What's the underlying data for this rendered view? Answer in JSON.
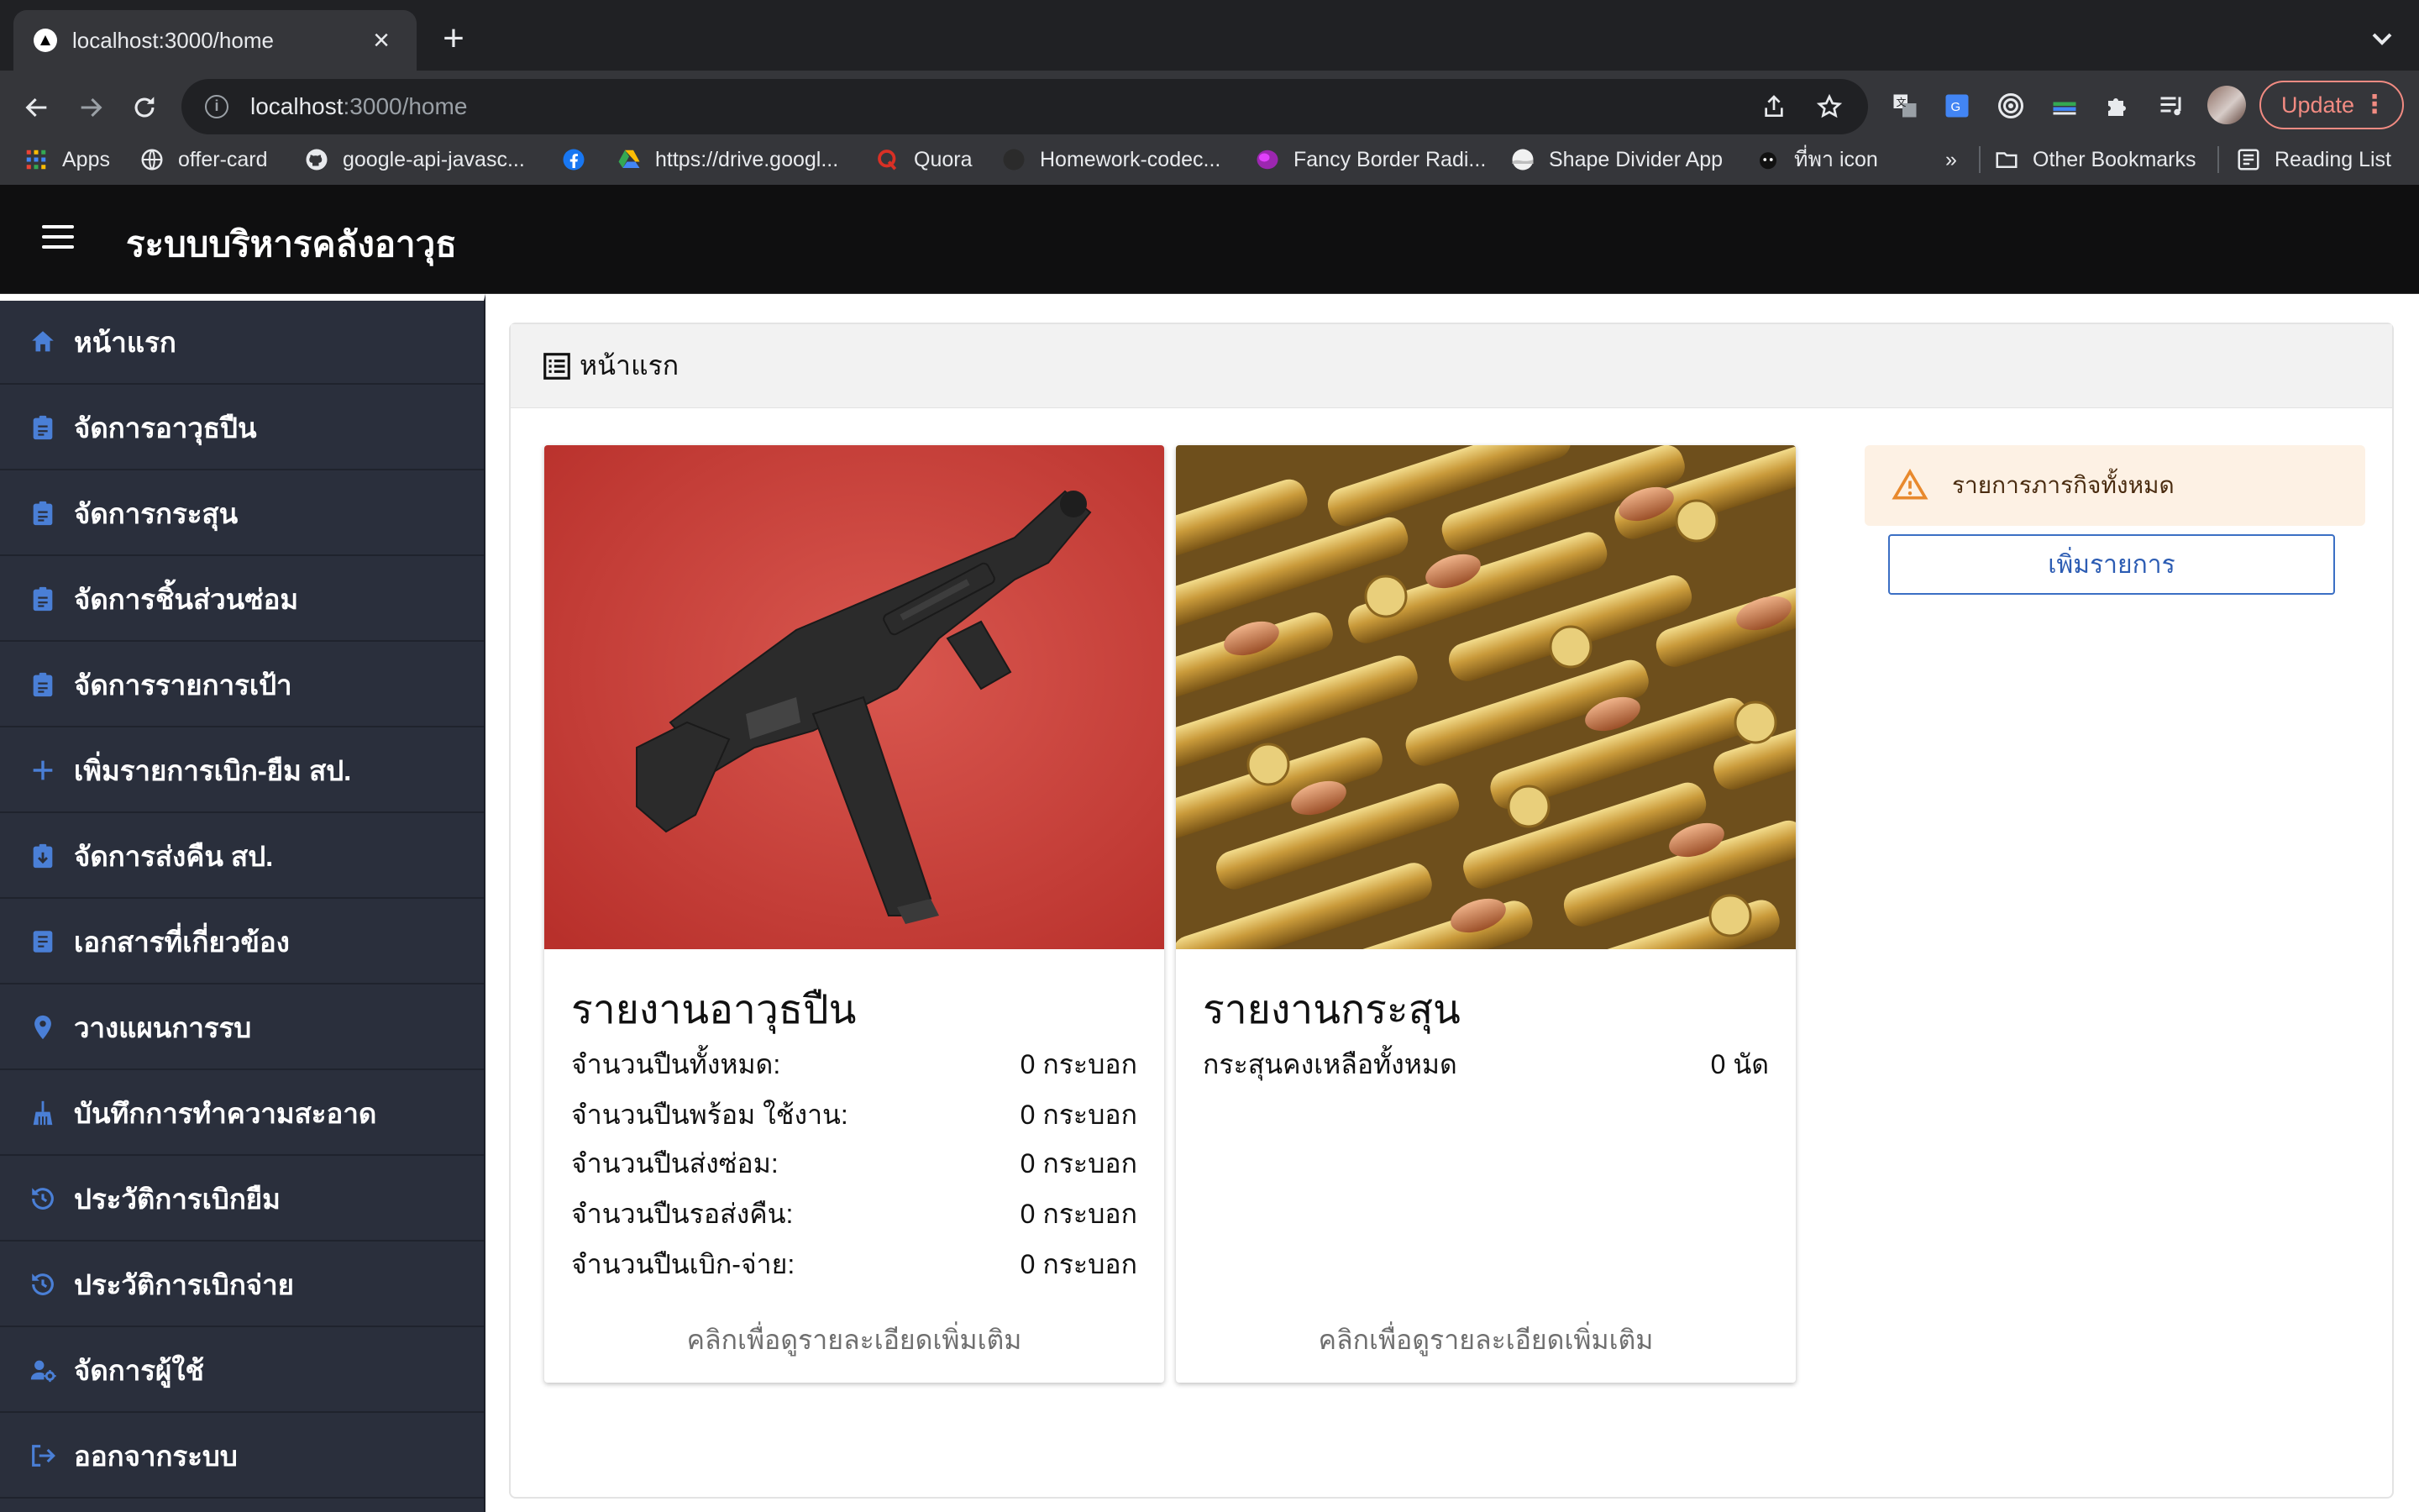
{
  "browser": {
    "tab_title": "localhost:3000/home",
    "tab_close": "×",
    "new_tab": "+",
    "url_host": "localhost",
    "url_path": ":3000/home",
    "update_label": "Update",
    "update_dots": "⋮"
  },
  "bookmarks": {
    "items": [
      {
        "label": "Apps",
        "icon": "apps-grid-icon"
      },
      {
        "label": "offer-card",
        "icon": "globe-icon"
      },
      {
        "label": "google-api-javasc...",
        "icon": "github-icon"
      },
      {
        "label": "",
        "icon": "facebook-icon"
      },
      {
        "label": "https://drive.googl...",
        "icon": "google-drive-icon"
      },
      {
        "label": "Quora",
        "icon": "quora-icon"
      },
      {
        "label": "Homework-codec...",
        "icon": "codecamp-icon"
      },
      {
        "label": "Fancy Border Radi...",
        "icon": "purple-blob-icon"
      },
      {
        "label": "Shape Divider App",
        "icon": "shape-divider-icon"
      },
      {
        "label": "ที่พา icon",
        "icon": "emoji-icon"
      }
    ],
    "overflow": "»",
    "other_bookmarks": "Other Bookmarks",
    "reading_list": "Reading List"
  },
  "app": {
    "title": "ระบบบริหารคลังอาวุธ"
  },
  "sidebar": {
    "items": [
      {
        "label": "หน้าแรก",
        "icon": "home-icon"
      },
      {
        "label": "จัดการอาวุธปืน",
        "icon": "clipboard-icon"
      },
      {
        "label": "จัดการกระสุน",
        "icon": "clipboard-icon"
      },
      {
        "label": "จัดการชิ้นส่วนซ่อม",
        "icon": "clipboard-icon"
      },
      {
        "label": "จัดการรายการเป้า",
        "icon": "clipboard-icon"
      },
      {
        "label": "เพิ่มรายการเบิก-ยืม สป.",
        "icon": "plus-icon"
      },
      {
        "label": "จัดการส่งคืน สป.",
        "icon": "clipboard-return-icon"
      },
      {
        "label": "เอกสารที่เกี่ยวข้อง",
        "icon": "document-icon"
      },
      {
        "label": "วางแผนการรบ",
        "icon": "location-pin-icon"
      },
      {
        "label": "บันทึกการทำความสะอาด",
        "icon": "cleaning-broom-icon"
      },
      {
        "label": "ประวัติการเบิกยืม",
        "icon": "history-icon"
      },
      {
        "label": "ประวัติการเบิกจ่าย",
        "icon": "history-icon"
      },
      {
        "label": "จัดการผู้ใช้",
        "icon": "manage-users-icon"
      },
      {
        "label": "ออกจากระบบ",
        "icon": "logout-icon"
      }
    ]
  },
  "main": {
    "header_title": "หน้าแรก",
    "gun_card": {
      "title": "รายงานอาวุธปืน",
      "stats": [
        {
          "label": "จำนวนปืนทั้งหมด:",
          "value": "0 กระบอก"
        },
        {
          "label": "จำนวนปืนพร้อม ใช้งาน:",
          "value": "0 กระบอก"
        },
        {
          "label": "จำนวนปืนส่งซ่อม:",
          "value": "0 กระบอก"
        },
        {
          "label": "จำนวนปืนรอส่งคืน:",
          "value": "0 กระบอก"
        },
        {
          "label": "จำนวนปืนเบิก-จ่าย:",
          "value": "0 กระบอก"
        }
      ],
      "more": "คลิกเพื่อดูรายละเอียดเพิ่มเติม"
    },
    "ammo_card": {
      "title": "รายงานกระสุน",
      "stats": [
        {
          "label": "กระสุนคงเหลือทั้งหมด",
          "value": "0 นัด"
        }
      ],
      "more": "คลิกเพื่อดูรายละเอียดเพิ่มเติม"
    },
    "tasks": {
      "alert_text": "รายการภารกิจทั้งหมด",
      "add_button": "เพิ่มรายการ"
    }
  },
  "colors": {
    "sidebar_bg": "#2a2f3c",
    "sidebar_icon": "#4a7fd6",
    "header_bg": "#0f0f10",
    "alert_bg": "#fdf1e4",
    "alert_icon": "#e8892d",
    "button_border": "#3b6fc4"
  }
}
